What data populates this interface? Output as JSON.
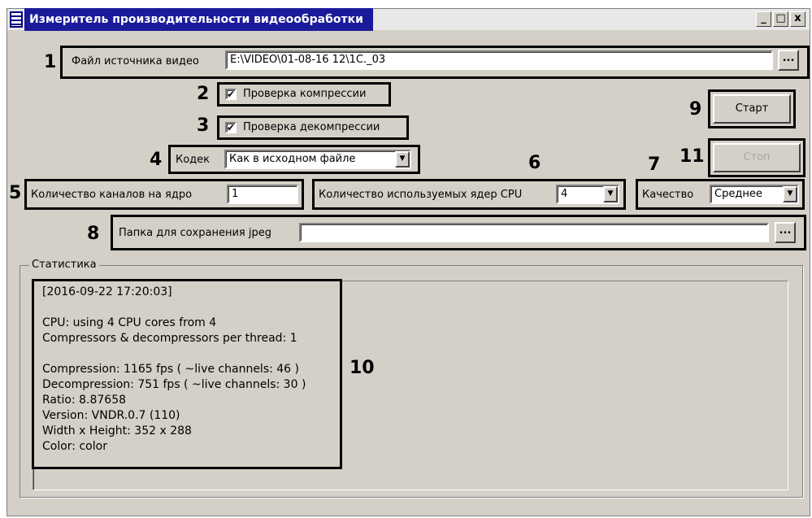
{
  "window": {
    "title": "Измеритель производительности видеообработки",
    "min_label": "_",
    "max_label": "□",
    "close_label": "x"
  },
  "callouts": [
    "1",
    "2",
    "3",
    "4",
    "5",
    "6",
    "7",
    "8",
    "9",
    "10",
    "11"
  ],
  "source": {
    "label": "Файл источника видео",
    "value": "E:\\VIDEO\\01-08-16 12\\1C._03",
    "browse_label": "..."
  },
  "compression_check": {
    "label": "Проверка компрессии",
    "checked": true,
    "mark": "✔"
  },
  "decompression_check": {
    "label": "Проверка декомпрессии",
    "checked": true,
    "mark": "✔"
  },
  "codec": {
    "label": "Кодек",
    "value": "Как в исходном файле",
    "arrow": "▼"
  },
  "channels": {
    "label": "Количество каналов на ядро",
    "value": "1"
  },
  "cores": {
    "label": "Количество используемых ядер CPU",
    "value": "4",
    "arrow": "▼"
  },
  "quality": {
    "label": "Качество",
    "value": "Среднее",
    "arrow": "▼"
  },
  "jpeg_folder": {
    "label": "Папка для сохранения jpeg",
    "value": "",
    "browse_label": "..."
  },
  "buttons": {
    "start": "Старт",
    "stop": "Стоп",
    "stop_disabled": true
  },
  "stats": {
    "group_label": "Статистика",
    "lines": [
      "[2016-09-22 17:20:03]",
      "",
      "CPU: using 4 CPU cores from 4",
      "Compressors & decompressors per thread: 1",
      "",
      "Compression: 1165 fps ( ~live channels: 46 )",
      "Decompression: 751 fps ( ~live channels: 30 )",
      "Ratio: 8.87658",
      "Version: VNDR.0.7 (110)",
      "Width x Height: 352 x 288",
      "Color: color"
    ]
  }
}
